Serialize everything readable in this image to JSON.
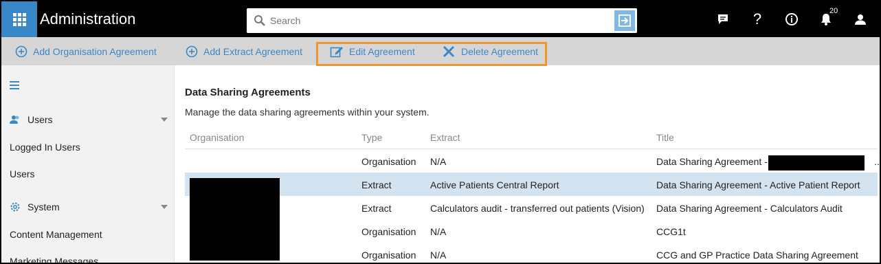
{
  "header": {
    "title": "Administration",
    "search_placeholder": "Search",
    "notification_count": "20",
    "icons": [
      "apps-icon",
      "search-icon",
      "submit-arrow-icon",
      "chat-icon",
      "help-icon",
      "info-icon",
      "bell-icon",
      "user-icon"
    ]
  },
  "toolbar": {
    "add_org_label": "Add Organisation Agreement",
    "add_extract_label": "Add Extract Agreement",
    "edit_label": "Edit Agreement",
    "delete_label": "Delete Agreement",
    "highlight_color": "#f0952a"
  },
  "sidebar": {
    "groups": [
      {
        "label": "Users",
        "items": [
          "Logged In Users",
          "Users"
        ]
      },
      {
        "label": "System",
        "items": [
          "Content Management",
          "Marketing Messages"
        ]
      }
    ]
  },
  "main": {
    "title": "Data Sharing Agreements",
    "description": "Manage the data sharing agreements within your system.",
    "columns": [
      "Organisation",
      "Type",
      "Extract",
      "Title"
    ],
    "rows": [
      {
        "organisation": "",
        "type": "Organisation",
        "extract": "N/A",
        "title": "Data Sharing Agreement -",
        "title_suffix": "..",
        "selected": false
      },
      {
        "organisation": "",
        "type": "Extract",
        "extract": "Active Patients Central Report",
        "title": "Data Sharing Agreement - Active Patient Report",
        "selected": true
      },
      {
        "organisation": "",
        "type": "Extract",
        "extract": "Calculators audit - transferred out patients (Vision)",
        "title": "Data Sharing Agreement - Calculators Audit",
        "selected": false
      },
      {
        "organisation": "",
        "type": "Organisation",
        "extract": "N/A",
        "title": "CCG1t",
        "selected": false
      },
      {
        "organisation": "",
        "type": "Organisation",
        "extract": "N/A",
        "title": "CCG and GP Practice Data Sharing Agreement",
        "selected": false
      }
    ]
  },
  "colors": {
    "accent": "#3a87c8",
    "header_bg": "#000000",
    "toolbar_bg": "#d6d6d6",
    "sidebar_bg": "#f2f2f2",
    "selected_row": "#d4e3f0"
  }
}
